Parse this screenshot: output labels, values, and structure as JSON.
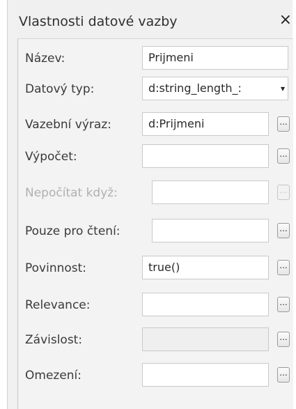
{
  "panel": {
    "title": "Vlastnosti datové vazby",
    "close_glyph": "×"
  },
  "rows": [
    {
      "label": "Název:",
      "value": "Prijmeni",
      "disabled": false
    },
    {
      "label": "Datový typ:",
      "value": "d:string_length_:",
      "dropdown_arrow": "▾",
      "disabled": false
    },
    {
      "label": "Vazební výraz:",
      "value": "d:Prijmeni",
      "button": "...",
      "disabled": false
    },
    {
      "label": "Výpočet:",
      "value": "",
      "button": "...",
      "disabled": false
    },
    {
      "label": "Nepočítat když:",
      "value": "",
      "button": "...",
      "disabled": true
    },
    {
      "label": "Pouze pro čtení:",
      "value": "",
      "button": "...",
      "disabled": false
    },
    {
      "label": "Povinnost:",
      "value": "true()",
      "button": "...",
      "disabled": false
    },
    {
      "label": "Relevance:",
      "value": "",
      "button": "...",
      "disabled": false
    },
    {
      "label": "Závislost:",
      "value": "",
      "button": "...",
      "disabled": false
    },
    {
      "label": "Omezení:",
      "value": "",
      "button": "...",
      "disabled": false
    }
  ]
}
